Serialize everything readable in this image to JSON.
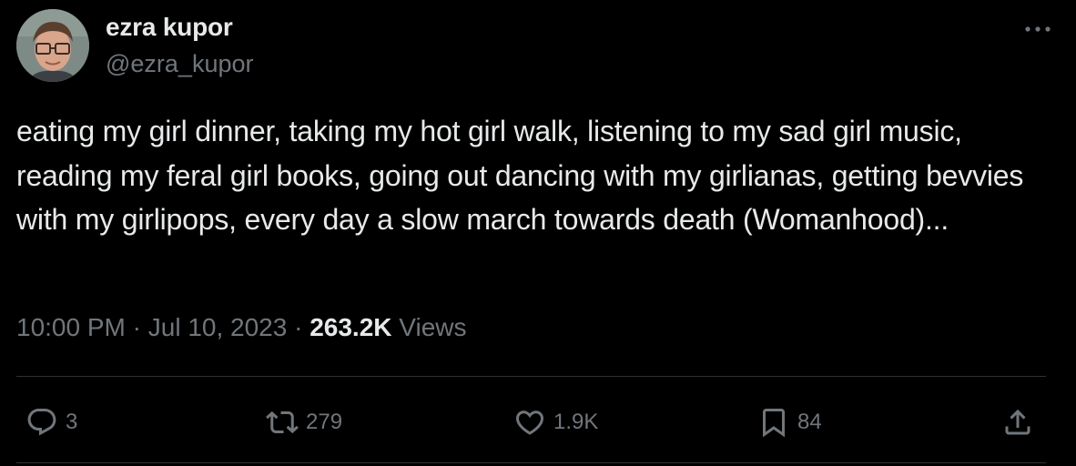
{
  "author": {
    "display_name": "ezra kupor",
    "handle": "@ezra_kupor"
  },
  "tweet": {
    "text": "eating my girl dinner, taking my hot girl walk, listening to my sad girl music, reading my feral girl books, going out dancing with my girlianas, getting bevvies with my girlipops, every day a slow march towards death (Womanhood)..."
  },
  "meta": {
    "time": "10:00 PM",
    "separator": " · ",
    "date": "Jul 10, 2023",
    "views_count": "263.2K",
    "views_label": "Views"
  },
  "actions": {
    "replies": "3",
    "retweets": "279",
    "likes": "1.9K",
    "bookmarks": "84"
  },
  "icons": {
    "more": "more-horizontal-icon",
    "reply": "reply-icon",
    "retweet": "retweet-icon",
    "like": "heart-icon",
    "bookmark": "bookmark-icon",
    "share": "share-icon"
  },
  "colors": {
    "background": "#000000",
    "primary_text": "#e7e9ea",
    "secondary_text": "#71767b",
    "divider": "#2f3336"
  }
}
